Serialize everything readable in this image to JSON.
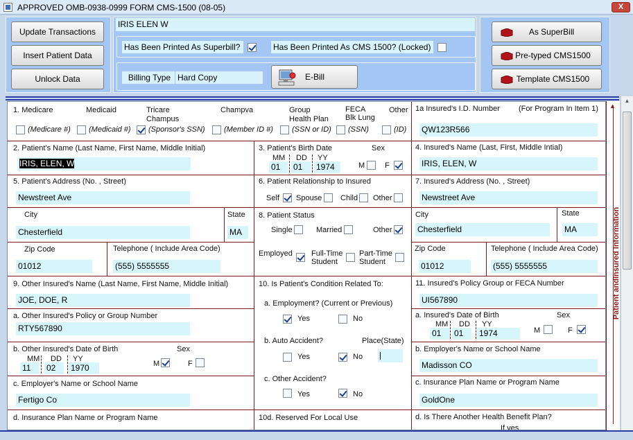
{
  "window": {
    "title": "APPROVED OMB-0938-0999 FORM CMS-1500 (08-05)",
    "close_label": "X"
  },
  "toolbar": {
    "update_btn": "Update Transactions",
    "insert_btn": "Insert Patient Data",
    "unlock_btn": "Unlock Data",
    "patient_name": "IRIS ELEN W",
    "printed_superbill_label": "Has Been Printed As Superbill?",
    "printed_superbill_checked": true,
    "printed_cms_label": "Has Been Printed As CMS 1500? (Locked)",
    "printed_cms_checked": false,
    "billing_type_label": "Billing Type",
    "billing_type_value": "Hard Copy",
    "ebill_btn": "E-Bill",
    "superbill_btn": "As SuperBill",
    "pretyped_btn": "Pre-typed CMS1500",
    "template_btn": "Template CMS1500"
  },
  "form": {
    "sec1": {
      "medicare": "1.     Medicare",
      "medicaid": "Medicaid",
      "tricare": "Tricare",
      "champus": "Champus",
      "champva": "Champva",
      "group": "Group",
      "healthplan": "Health Plan",
      "feca": "FECA",
      "blklung": "Blk Lung",
      "other": "Other",
      "medicare_id": "(Medicare #)",
      "medicaid_id": "(Medicaid #)",
      "sponsor_ssn": "(Sponsor's SSN)",
      "member_id": "(Member ID #)",
      "ssn_or_id": "(SSN or ID)",
      "ssn": "(SSN)",
      "id": "(ID)"
    },
    "sec1a": {
      "label": "1a  Insured's I.D. Number",
      "program": "(For Program In Item 1)",
      "value": "QW123R566"
    },
    "sec2": {
      "label": "2.  Patient's Name (Last Name, First Name, Middle Initial)",
      "value": "IRIS, ELEN, W"
    },
    "sec3": {
      "label": "3.  Patient's Birth Date",
      "sex": "Sex",
      "mm": "MM",
      "dd": "DD",
      "yy": "YY",
      "mm_v": "01",
      "dd_v": "01",
      "yy_v": "1974",
      "m": "M",
      "f": "F"
    },
    "sec4": {
      "label": "4.  Insured's Name (Last, First, Middle Intial)",
      "value": "IRIS, ELEN, W"
    },
    "sec5": {
      "label": "5.  Patient's Address (No. , Street)",
      "value": "Newstreet Ave",
      "city_label": "City",
      "city": "Chesterfield",
      "state_label": "State",
      "state": "MA",
      "zip_label": "Zip Code",
      "zip": "01012",
      "tel_label": "Telephone ( Include Area Code)",
      "area": "555",
      "tel": "5555555"
    },
    "sec6": {
      "label": "6.  Patient Relationship to Insured",
      "self": "Self",
      "spouse": "Spouse",
      "child": "Child",
      "other": "Other"
    },
    "sec7": {
      "label": "7.  Insured's Address (No. , Street)",
      "value": "Newstreet Ave",
      "city_label": "City",
      "city": "Chesterfield",
      "state_label": "State",
      "state": "MA",
      "zip_label": "Zip Code",
      "zip": "01012",
      "tel_label": "Telephone ( Include Area Code)",
      "area": "555",
      "tel": "5555555"
    },
    "sec8": {
      "label": "8.  Patient Status",
      "single": "Single",
      "married": "Married",
      "other": "Other",
      "employed": "Employed",
      "fulltime": "Full-Time",
      "student": "Student",
      "parttime": "Part-Time",
      "student2": "Student"
    },
    "sec9": {
      "label": "9.  Other Insured's Name (Last Name, First Name, Middle Initial)",
      "value": "JOE, DOE, R",
      "a_label": "a.  Other Insured's Policy or Group Number",
      "a_value": "RTY567890",
      "b_label": "b.  Other Insured's Date of Birth",
      "b_sex": "Sex",
      "mm": "MM",
      "dd": "DD",
      "yy": "YY",
      "mm_v": "11",
      "dd_v": "02",
      "yy_v": "1970",
      "m": "M",
      "f": "F",
      "c_label": "c.  Employer's Name or School Name",
      "c_value": "Fertigo Co",
      "d_label": "d.  Insurance Plan Name or Program Name"
    },
    "sec10": {
      "label": "10. Is Patient's Condition Related To:",
      "a": "a. Employment? (Current or Previous)",
      "b": "b. Auto Accident?",
      "place": "Place(State)",
      "c": "c. Other Accident?",
      "yes": "Yes",
      "no": "No",
      "d": "10d. Reserved For Local Use"
    },
    "sec11": {
      "label": "11.  Insured's Policy Group or FECA Number",
      "value": "UI567890",
      "a_label": "a.  Insured's Date of Birth",
      "sex": "Sex",
      "mm": "MM",
      "dd": "DD",
      "yy": "YY",
      "mm_v": "01",
      "dd_v": "01",
      "yy_v": "1974",
      "m": "M",
      "f": "F",
      "b_label": "b.  Employer's Name or School Name",
      "b_value": "Madisson CO",
      "c_label": "c.  Insurance Plan Name or Program Name",
      "c_value": "GoldOne",
      "d_label": "d.  Is There Another Health Benefit Plan?",
      "d_partial": "If yes"
    }
  },
  "sidebar_text": "Patient andInsured Information",
  "colors": {
    "accent": "#2a3aa5",
    "panel": "#a3c6f5",
    "field": "#d7f6fb",
    "grid": "#7b1c1c"
  }
}
